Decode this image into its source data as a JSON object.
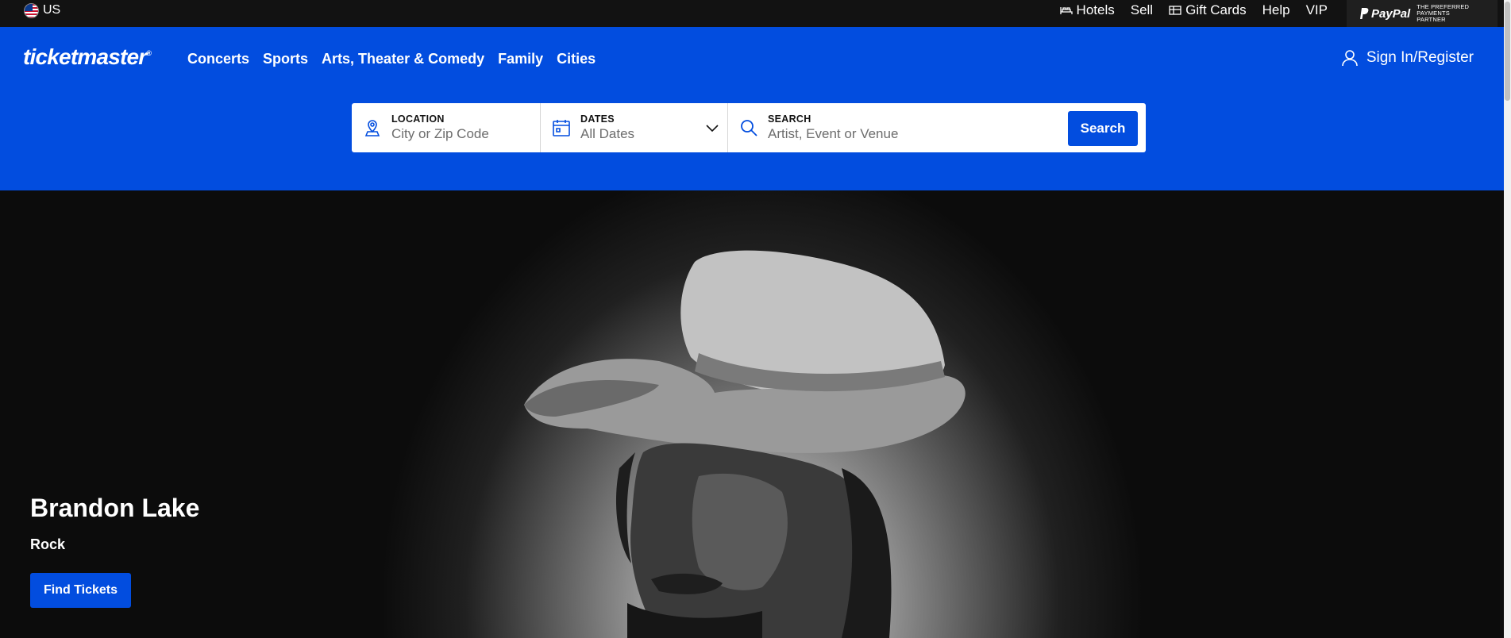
{
  "utility": {
    "region": "US",
    "links": [
      {
        "label": "Hotels",
        "icon": "bed-icon"
      },
      {
        "label": "Sell",
        "icon": ""
      },
      {
        "label": "Gift Cards",
        "icon": "gift-card-icon"
      },
      {
        "label": "Help",
        "icon": ""
      },
      {
        "label": "VIP",
        "icon": ""
      }
    ],
    "paypal": {
      "brand": "PayPal",
      "tagline": "The Preferred Payments Partner"
    }
  },
  "header": {
    "logo": "ticketmaster",
    "logo_mark": "®",
    "nav": [
      "Concerts",
      "Sports",
      "Arts, Theater & Comedy",
      "Family",
      "Cities"
    ],
    "signin_label": "Sign In/Register"
  },
  "search": {
    "location_label": "LOCATION",
    "location_placeholder": "City or Zip Code",
    "dates_label": "DATES",
    "dates_value": "All Dates",
    "search_label": "SEARCH",
    "search_placeholder": "Artist, Event or Venue",
    "button_label": "Search"
  },
  "hero": {
    "title": "Brandon Lake",
    "genre": "Rock",
    "cta_label": "Find Tickets"
  },
  "colors": {
    "brand_blue": "#024ddf",
    "top_bar": "#121212"
  }
}
